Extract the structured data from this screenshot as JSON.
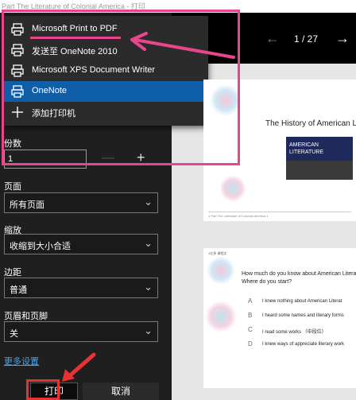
{
  "window": {
    "title": "Part The Literature of Colonial America - 打印"
  },
  "printer_menu": {
    "items": [
      {
        "label": "Microsoft Print to PDF",
        "icon": "printer-icon",
        "selected": false
      },
      {
        "label": "发送至 OneNote 2010",
        "icon": "printer-icon",
        "selected": false
      },
      {
        "label": "Microsoft XPS Document Writer",
        "icon": "printer-icon",
        "selected": false
      },
      {
        "label": "OneNote",
        "icon": "printer-icon",
        "selected": true
      },
      {
        "label": "添加打印机",
        "icon": "plus-icon",
        "selected": false
      }
    ]
  },
  "settings": {
    "copies_label": "份数",
    "copies_value": "1",
    "minus": "—",
    "plus": "+",
    "pages_label": "页面",
    "pages_value": "所有页面",
    "scale_label": "缩放",
    "scale_value": "收缩到大小合适",
    "margins_label": "边距",
    "margins_value": "普通",
    "header_footer_label": "页眉和页脚",
    "header_footer_value": "关",
    "more_settings": "更多设置"
  },
  "buttons": {
    "print": "打印",
    "cancel": "取消"
  },
  "preview": {
    "page_indicator": "1 / 27",
    "page1": {
      "title": "The History of American Lite",
      "book_text": "AMERICAN LITERATURE",
      "footer": "1 Part The Literature of Colonial America 1"
    },
    "page2": {
      "header": "1亿多 课程文",
      "question": "How much do you know about American Literat\nWhere do you start?",
      "options": [
        {
          "letter": "A",
          "text": "I knew nothing about American Literat"
        },
        {
          "letter": "B",
          "text": "I heard some names and literary forms"
        },
        {
          "letter": "C",
          "text": "I read some works （中段位）"
        },
        {
          "letter": "D",
          "text": "I knew ways of appreciate literary work"
        }
      ]
    }
  },
  "colors": {
    "accent": "#0f5fa8",
    "annotation": "#e8458d",
    "annotation_red": "#e83232"
  }
}
